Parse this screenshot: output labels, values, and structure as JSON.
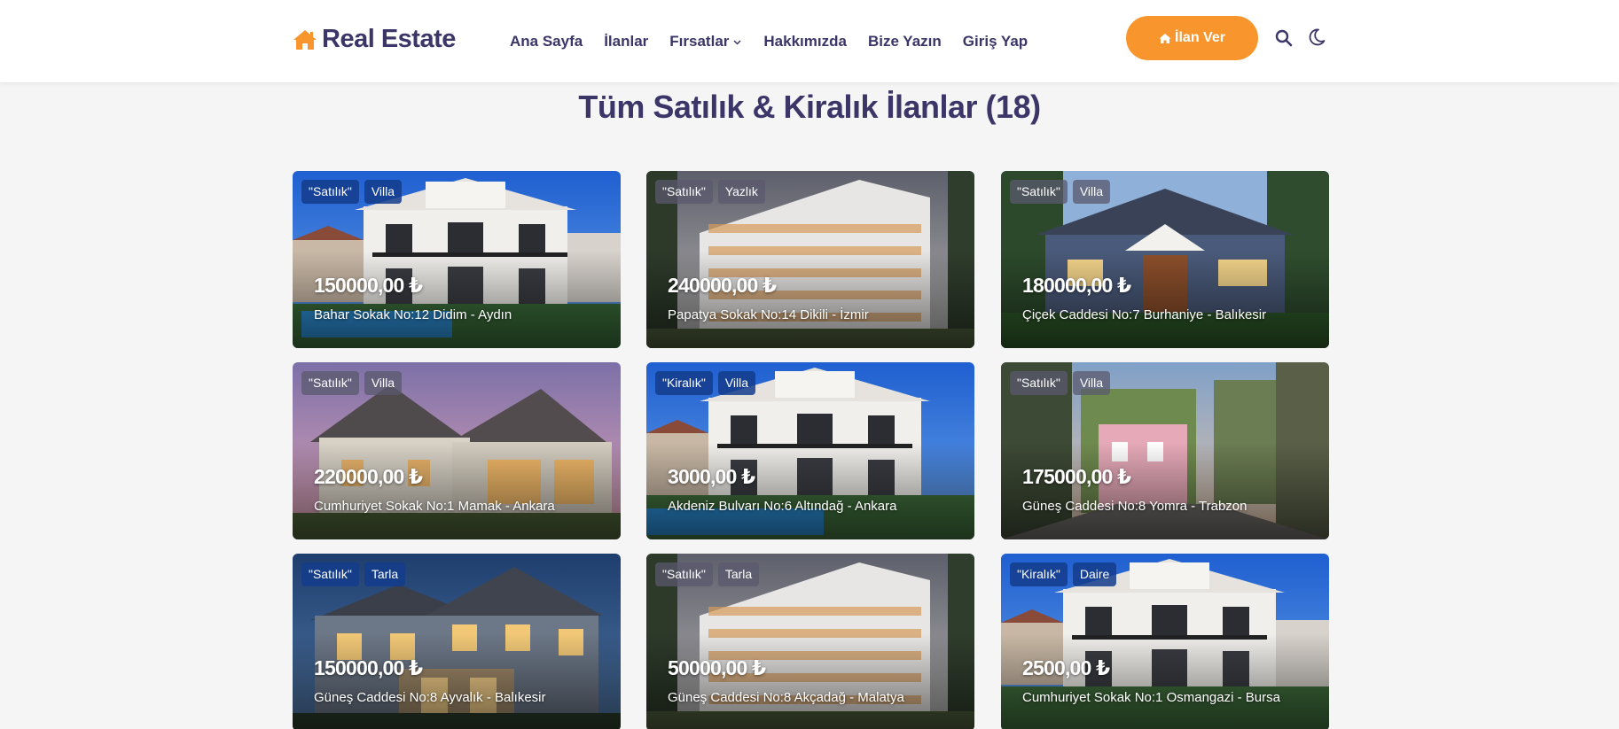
{
  "brand": {
    "name": "Real Estate",
    "icon": "home-icon",
    "icon_color": "#f8952c"
  },
  "nav": {
    "home": "Ana Sayfa",
    "listings": "İlanlar",
    "deals": "Fırsatlar",
    "about": "Hakkımızda",
    "contact": "Bize Yazın",
    "login": "Giriş Yap"
  },
  "cta": {
    "label": "İlan Ver",
    "icon": "home-icon",
    "color": "#f8952c"
  },
  "tools": {
    "search_icon": "search-icon",
    "theme_icon": "moon-icon"
  },
  "page": {
    "title": "Tüm Satılık & Kiralık İlanlar (18)"
  },
  "listings": [
    {
      "status": "\"Satılık\"",
      "type": "Villa",
      "price": "150000,00 ₺",
      "address": "Bahar Sokak No:12 Didim - Aydın"
    },
    {
      "status": "\"Satılık\"",
      "type": "Yazlık",
      "price": "240000,00 ₺",
      "address": "Papatya Sokak No:14 Dikili - İzmir"
    },
    {
      "status": "\"Satılık\"",
      "type": "Villa",
      "price": "180000,00 ₺",
      "address": "Çiçek Caddesi No:7 Burhaniye - Balıkesir"
    },
    {
      "status": "\"Satılık\"",
      "type": "Villa",
      "price": "220000,00 ₺",
      "address": "Cumhuriyet Sokak No:1 Mamak - Ankara"
    },
    {
      "status": "\"Kiralık\"",
      "type": "Villa",
      "price": "3000,00 ₺",
      "address": "Akdeniz Bulvarı No:6 Altındağ - Ankara"
    },
    {
      "status": "\"Satılık\"",
      "type": "Villa",
      "price": "175000,00 ₺",
      "address": "Güneş Caddesi No:8 Yomra - Trabzon"
    },
    {
      "status": "\"Satılık\"",
      "type": "Tarla",
      "price": "150000,00 ₺",
      "address": "Güneş Caddesi No:8 Ayvalık - Balıkesir"
    },
    {
      "status": "\"Satılık\"",
      "type": "Tarla",
      "price": "50000,00 ₺",
      "address": "Güneş Caddesi No:8 Akçadağ - Malatya"
    },
    {
      "status": "\"Kiralık\"",
      "type": "Daire",
      "price": "2500,00 ₺",
      "address": "Cumhuriyet Sokak No:1 Osmangazi - Bursa"
    }
  ]
}
